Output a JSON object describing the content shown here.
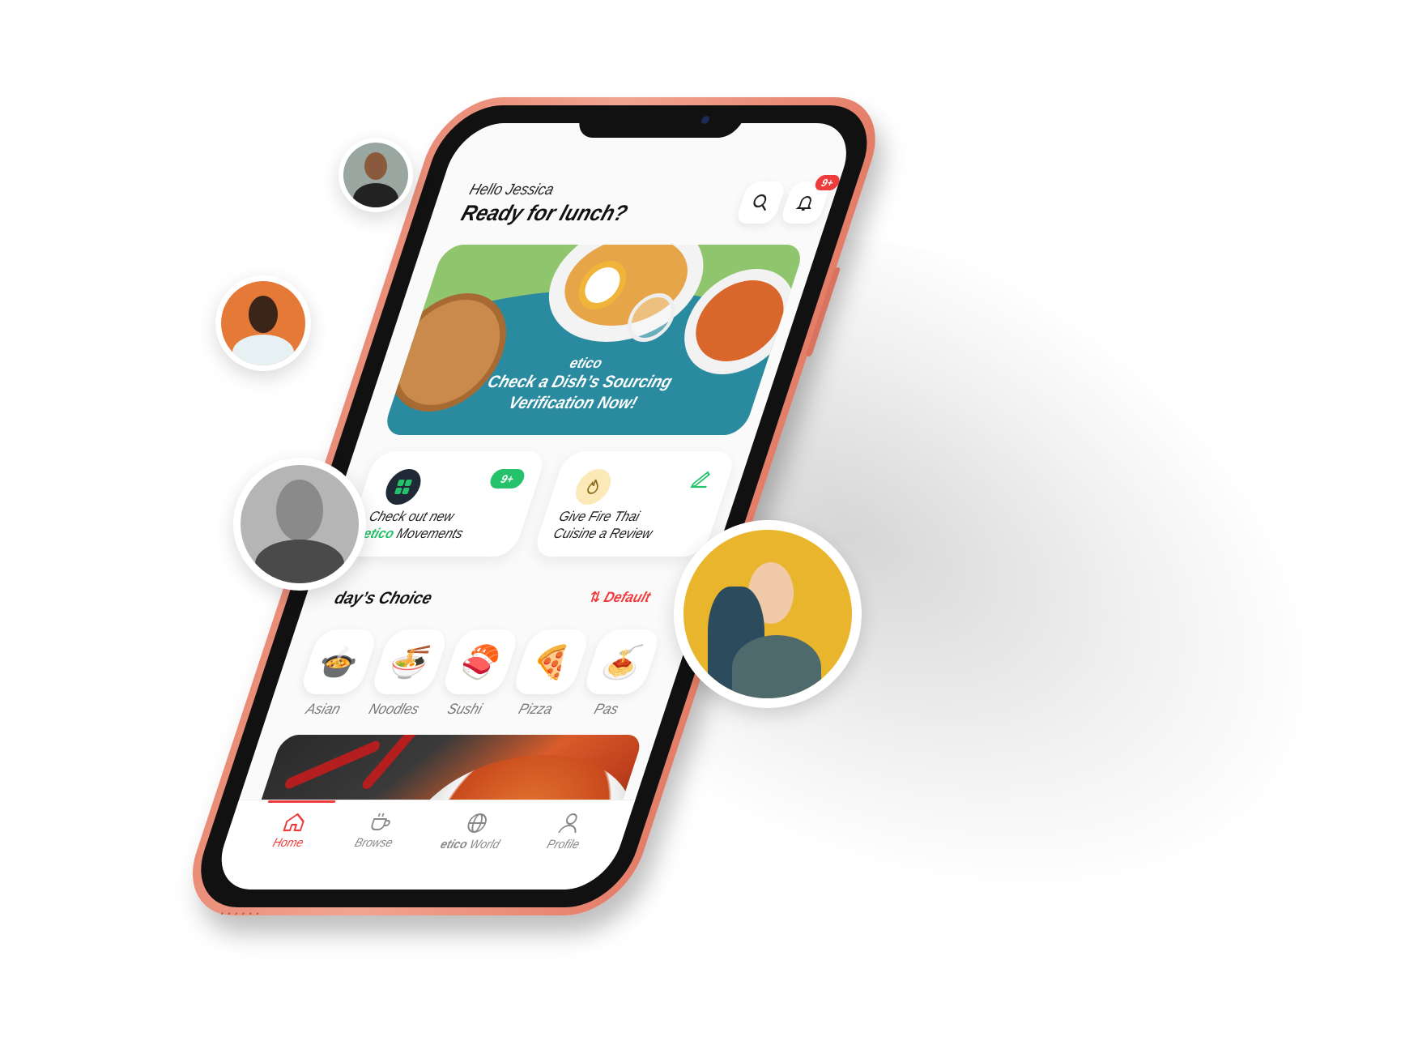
{
  "header": {
    "greeting": "Hello Jessica",
    "headline": "Ready for lunch?",
    "notification_badge": "9+"
  },
  "banner": {
    "brand": "etico",
    "line1": "Check a Dish’s Sourcing",
    "line2": "Verification Now!"
  },
  "cards": [
    {
      "badge": "9+",
      "text_line1": "Check out new",
      "brand": "etico",
      "text_line2_suffix": " Movements"
    },
    {
      "text_line1": "Give Fire Thai",
      "text_line2": "Cuisine a Review"
    }
  ],
  "section": {
    "title": "day’s Choice",
    "sort_label": "Default"
  },
  "categories": [
    {
      "label": "Asian",
      "icon": "bowl-icon"
    },
    {
      "label": "Noodles",
      "icon": "noodles-icon"
    },
    {
      "label": "Sushi",
      "icon": "sushi-icon"
    },
    {
      "label": "Pizza",
      "icon": "pizza-icon"
    },
    {
      "label": "Pas",
      "icon": "pasta-icon"
    }
  ],
  "tabs": [
    {
      "label": "Home",
      "icon": "home-icon",
      "active": true
    },
    {
      "label": "Browse",
      "icon": "coffee-cup-icon"
    },
    {
      "label": "etico World",
      "brand": "etico",
      "suffix": " World",
      "icon": "globe-icon"
    },
    {
      "label": "Profile",
      "icon": "user-icon"
    }
  ],
  "colors": {
    "accent_red": "#ee3b3b",
    "brand_green": "#25c26b",
    "banner_teal": "#2a8ba0",
    "phone_coral": "#f2a591"
  }
}
